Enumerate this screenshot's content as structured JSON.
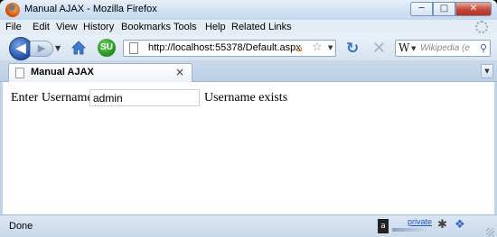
{
  "window": {
    "title": "Manual AJAX - Mozilla Firefox",
    "controls": {
      "minimize": "─",
      "maximize": "□",
      "close": "✕"
    }
  },
  "menu": [
    {
      "label": "File"
    },
    {
      "label": "Edit"
    },
    {
      "label": "View"
    },
    {
      "label": "History"
    },
    {
      "label": "Bookmarks"
    },
    {
      "label": "Tools"
    },
    {
      "label": "Help"
    },
    {
      "label": "Related Links"
    }
  ],
  "nav": {
    "back_icon": "◀",
    "forward_icon": "▶",
    "url": "http://localhost:55378/Default.aspx",
    "search_placeholder": "Wikipedia (e",
    "search_engine_letter": "W",
    "stumbleupon": "SU"
  },
  "tabs": [
    {
      "label": "Manual AJAX",
      "close": "×"
    }
  ],
  "page": {
    "label": "Enter Username:",
    "input_value": "admin",
    "result": "Username exists"
  },
  "status": {
    "text": "Done",
    "private_label": "private",
    "security_glyph": "a"
  },
  "colors": {
    "chrome_blue": "#bcd3ea",
    "accent_blue": "#2553a9",
    "close_red": "#c4473a"
  }
}
